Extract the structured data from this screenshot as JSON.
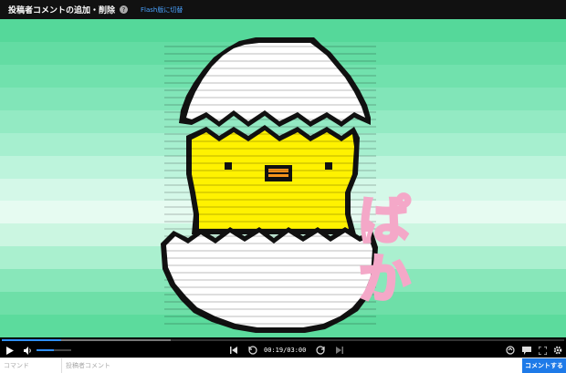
{
  "header": {
    "title": "投稿者コメントの追加・削除",
    "help_icon": "question-icon",
    "help_glyph": "?",
    "flash_link": "Flash版に切替"
  },
  "video": {
    "stripe_colors": [
      "#55d89a",
      "#63dca3",
      "#71e1ad",
      "#81e5b8",
      "#93eac3",
      "#a6efcf",
      "#bdf4dc",
      "#d4f8e8",
      "#e6fbf1",
      "#cbf6e1",
      "#aaf0cf",
      "#88e7ba",
      "#6edfa8",
      "#5cdb9d"
    ],
    "overlay_text": "ぱか",
    "overlay_color": "#f4a8c8"
  },
  "playback": {
    "current": "00:19",
    "duration": "03:00",
    "time_text": "00:19/03:00",
    "played_fraction": 0.106,
    "buffered_fraction": 0.3,
    "volume_fraction": 0.5
  },
  "controls": {
    "play_icon": "play-icon",
    "volume_icon": "volume-icon",
    "prev_icon": "skip-back-icon",
    "rewind_icon": "rewind-10-icon",
    "forward_icon": "forward-10-icon",
    "next_icon": "skip-forward-icon",
    "loop_icon": "loop-icon",
    "comment_toggle_icon": "comment-icon",
    "fullscreen_icon": "fullscreen-icon",
    "settings_icon": "gear-icon"
  },
  "comment_form": {
    "command_placeholder": "コマンド",
    "comment_placeholder": "投稿者コメント",
    "submit_label": "コメントする"
  }
}
